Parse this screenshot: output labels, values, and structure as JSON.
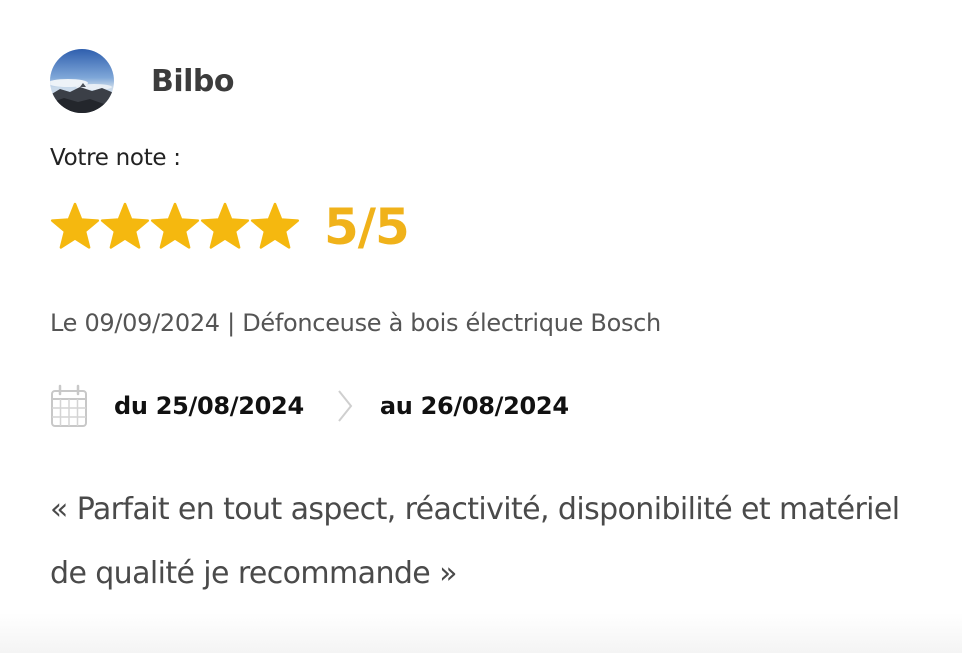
{
  "review": {
    "user": {
      "name": "Bilbo",
      "avatar_icon": "avatar-photo"
    },
    "rating_label": "Votre note :",
    "rating": {
      "score": 5,
      "max": 5,
      "display": "5/5",
      "star_color": "#f5b80f",
      "value_color": "#f0b21a"
    },
    "meta_line": "Le 09/09/2024 | Défonceuse à bois électrique Bosch",
    "rental_period": {
      "calendar_icon": "calendar-icon",
      "from": "du 25/08/2024",
      "separator_icon": "chevron-right-icon",
      "to": "au 26/08/2024"
    },
    "comment": "« Parfait en tout aspect, réactivité, disponibilité et matériel de qualité je recommande »"
  }
}
